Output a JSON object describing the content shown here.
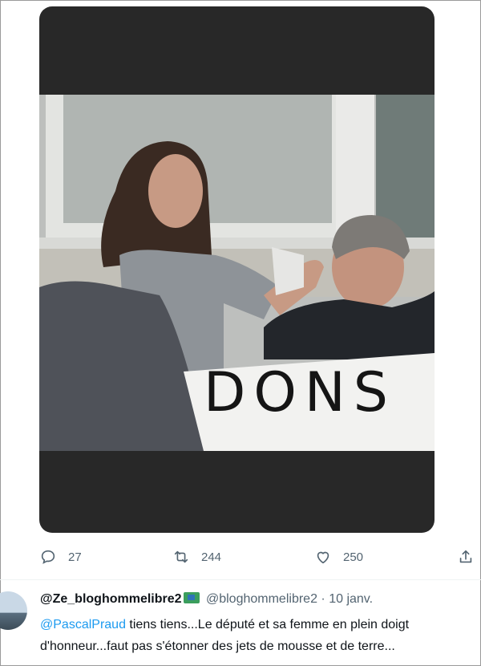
{
  "media": {
    "sign_text": "DONS"
  },
  "actions": {
    "reply_count": "27",
    "retweet_count": "244",
    "like_count": "250"
  },
  "reply_tweet": {
    "display_name": "@Ze_bloghommelibre2",
    "handle": "@bloghommelibre2",
    "separator": "·",
    "date": "10 janv.",
    "mention": "@PascalPraud",
    "text_line1": " tiens tiens...Le député et sa femme en plein doigt",
    "text_line2": "d'honneur...faut pas s'étonner des jets de mousse et de terre..."
  },
  "colors": {
    "media_background": "#282828",
    "mention": "#1d9bf0",
    "icon_gray": "#536471"
  },
  "icons": [
    "reply-icon",
    "retweet-icon",
    "like-icon",
    "share-icon",
    "map-emoji-icon"
  ]
}
